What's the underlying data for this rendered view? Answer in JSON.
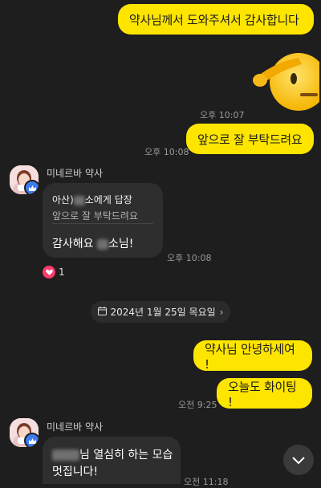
{
  "messages_mine": {
    "m1": "약사님께서 도와주셔서 감사합니다",
    "m2": "앞으로 잘 부탁드려요",
    "m3": "약사님 안녕하세여 !",
    "m4": "오늘도 화이팅 !"
  },
  "emoji": {
    "name": "saluting-face-icon"
  },
  "times": {
    "t1": "오후 10:07",
    "t2": "오후 10:08",
    "t3": "오후 10:08",
    "t4": "오전 9:25",
    "t5": "오전 11:18"
  },
  "sender": {
    "name": "미네르바 약사"
  },
  "reply_block": {
    "target_prefix": "아산)",
    "target_suffix": "소에게 답장",
    "quoted": "앞으로 잘 부탁드려요",
    "text_prefix": "감사해요 ",
    "text_suffix": "소님!"
  },
  "reaction": {
    "icon": "heart-icon",
    "count": "1"
  },
  "date_divider": {
    "label": "2024년 1월 25일 목요일"
  },
  "second_message": {
    "line1_suffix": "님 열심히 하는 모습",
    "line2": "멋집니다!"
  },
  "colors": {
    "background": "#1e1e1e",
    "my_bubble": "#fee500",
    "their_bubble": "#2e2e2e",
    "badge": "#3d7cf0",
    "reaction_heart": "#ff3b6b"
  }
}
